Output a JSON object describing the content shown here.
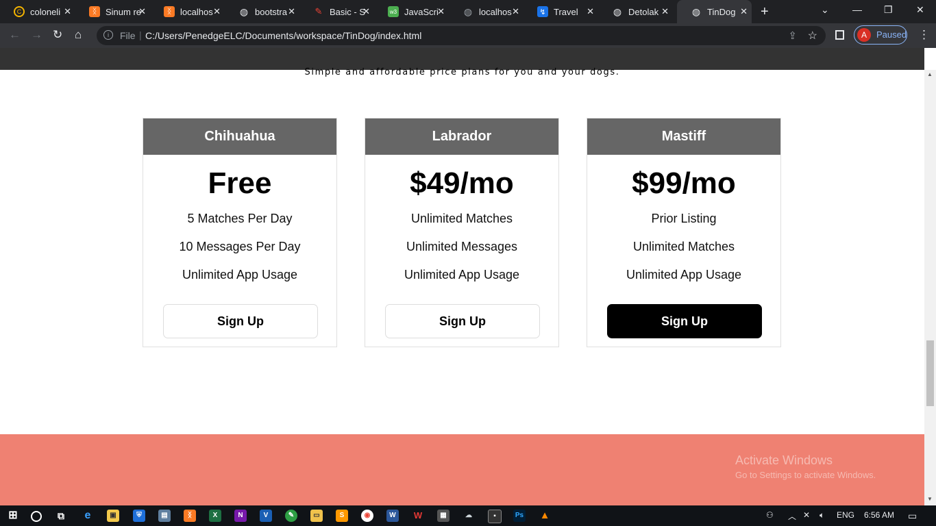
{
  "browser": {
    "tabs": [
      {
        "title": "coloneli",
        "icon": "google-drive-icon",
        "color": "#f4b400"
      },
      {
        "title": "Sinum re",
        "icon": "xampp-icon",
        "color": "#fb7a24"
      },
      {
        "title": "localhos",
        "icon": "xampp-icon",
        "color": "#fb7a24"
      },
      {
        "title": "bootstra",
        "icon": "globe-icon",
        "color": "#e8eaed"
      },
      {
        "title": "Basic - S",
        "icon": "basic-icon",
        "color": "#ea4335"
      },
      {
        "title": "JavaScri",
        "icon": "w3schools-icon",
        "color": "#4caf50"
      },
      {
        "title": "localhos",
        "icon": "globe-icon",
        "color": "#9aa0a6"
      },
      {
        "title": "Travel",
        "icon": "travel-icon",
        "color": "#1a73e8"
      },
      {
        "title": "Detolak",
        "icon": "globe-icon",
        "color": "#e8eaed"
      },
      {
        "title": "TinDog",
        "icon": "globe-icon",
        "color": "#e8eaed"
      }
    ],
    "file_label": "File",
    "url": "C:/Users/PenedgeELC/Documents/workspace/TinDog/index.html",
    "profile_initial": "A",
    "profile_status": "Paused"
  },
  "page": {
    "subtitle": "Simple and affordable price plans for you and your dogs.",
    "plans": [
      {
        "name": "Chihuahua",
        "price": "Free",
        "features": [
          "5 Matches Per Day",
          "10 Messages Per Day",
          "Unlimited App Usage"
        ],
        "button": "Sign Up",
        "button_style": "outline"
      },
      {
        "name": "Labrador",
        "price": "$49/mo",
        "features": [
          "Unlimited Matches",
          "Unlimited Messages",
          "Unlimited App Usage"
        ],
        "button": "Sign Up",
        "button_style": "outline"
      },
      {
        "name": "Mastiff",
        "price": "$99/mo",
        "features": [
          "Prior Listing",
          "Unlimited Matches",
          "Unlimited App Usage"
        ],
        "button": "Sign Up",
        "button_style": "dark"
      }
    ],
    "footer_color": "#ef8172",
    "watermark_title": "Activate Windows",
    "watermark_sub": "Go to Settings to activate Windows."
  },
  "taskbar": {
    "language": "ENG",
    "time": "6:56 AM"
  }
}
